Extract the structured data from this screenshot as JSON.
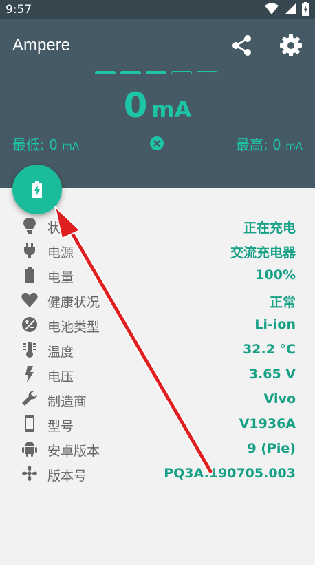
{
  "status_bar": {
    "time": "9:57"
  },
  "app": {
    "title": "Ampere"
  },
  "meter": {
    "current_value": "0",
    "current_unit": "mA",
    "min_label": "最低:",
    "min_value": "0",
    "min_unit": "mA",
    "max_label": "最高:",
    "max_value": "0",
    "max_unit": "mA",
    "dashes_filled": 3,
    "dashes_total": 5
  },
  "colors": {
    "header": "#455a64",
    "accent": "#1ec4a6",
    "value": "#16a085",
    "annotation_arrow": "#e02020"
  },
  "rows": [
    {
      "icon": "bulb-icon",
      "label": "状态",
      "value": "正在充电"
    },
    {
      "icon": "plug-icon",
      "label": "电源",
      "value": "交流充电器"
    },
    {
      "icon": "battery-icon",
      "label": "电量",
      "value": "100%"
    },
    {
      "icon": "heart-icon",
      "label": "健康状况",
      "value": "正常"
    },
    {
      "icon": "battery-type-icon",
      "label": "电池类型",
      "value": "Li-ion"
    },
    {
      "icon": "thermometer-icon",
      "label": "温度",
      "value": "32.2 °C"
    },
    {
      "icon": "voltage-icon",
      "label": "电压",
      "value": "3.65 V"
    },
    {
      "icon": "wrench-icon",
      "label": "制造商",
      "value": "Vivo"
    },
    {
      "icon": "phone-icon",
      "label": "型号",
      "value": "V1936A"
    },
    {
      "icon": "android-icon",
      "label": "安卓版本",
      "value": "9 (Pie)"
    },
    {
      "icon": "fan-icon",
      "label": "版本号",
      "value": "PQ3A.190705.003"
    }
  ]
}
